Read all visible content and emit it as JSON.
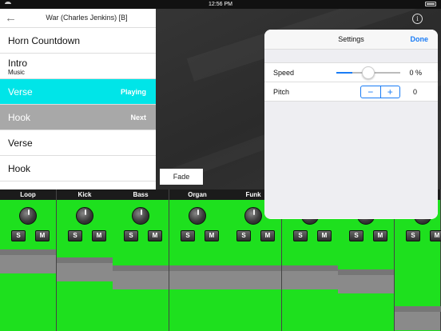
{
  "status": {
    "time": "12:56 PM"
  },
  "song": {
    "title": "War (Charles Jenkins) [B]",
    "parts": [
      {
        "name": "Horn Countdown",
        "sub": "",
        "state": ""
      },
      {
        "name": "Intro",
        "sub": "Music",
        "state": ""
      },
      {
        "name": "Verse",
        "sub": "",
        "state": "Playing"
      },
      {
        "name": "Hook",
        "sub": "",
        "state": "Next"
      },
      {
        "name": "Verse",
        "sub": "",
        "state": ""
      },
      {
        "name": "Hook",
        "sub": "",
        "state": ""
      }
    ]
  },
  "fade_label": "Fade",
  "mixer": {
    "channels": [
      {
        "label": "Loop",
        "level": 0.53
      },
      {
        "label": "Kick",
        "level": 0.47
      },
      {
        "label": "Bass",
        "level": 0.41
      },
      {
        "label": "Organ",
        "level": 0.41
      },
      {
        "label": "Funk",
        "level": 0.41
      },
      {
        "label": "",
        "level": 0.41
      },
      {
        "label": "",
        "level": 0.38
      },
      {
        "label": "",
        "level": 0.1
      }
    ],
    "solo_label": "S",
    "mute_label": "M"
  },
  "settings": {
    "title": "Settings",
    "done_label": "Done",
    "speed_label": "Speed",
    "speed_value": "0 %",
    "speed_fraction": 0.5,
    "pitch_label": "Pitch",
    "pitch_value": "0",
    "minus": "−",
    "plus": "+"
  },
  "colors": {
    "playing": "#00e5e8",
    "next": "#a8a8a8",
    "channel": "#1ee01e",
    "accent": "#1a7cf5"
  },
  "icons": {
    "info": "i",
    "back": "←"
  }
}
